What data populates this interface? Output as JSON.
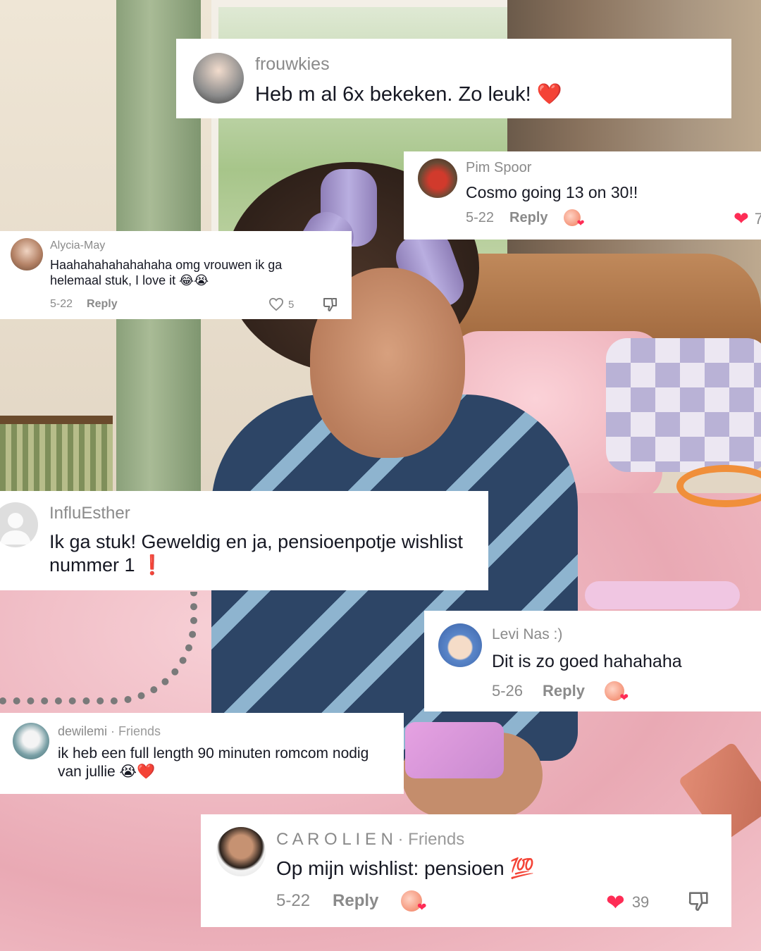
{
  "comments": [
    {
      "username": "frouwkies",
      "text": "Heb m al 6x bekeken. Zo leuk! ❤️"
    },
    {
      "username": "Pim Spoor",
      "text": "Cosmo going 13 on 30!!",
      "date": "5-22",
      "reply_label": "Reply",
      "likes": "7"
    },
    {
      "username": "Alycia-May",
      "text": "Haahahahahahahaha omg vrouwen ik ga helemaal stuk, I love it 😂😭",
      "date": "5-22",
      "reply_label": "Reply",
      "likes": "5"
    },
    {
      "username": "InfluEsther",
      "text": "Ik ga stuk! Geweldig en ja, pensioenpotje wishlist nummer 1 ❗"
    },
    {
      "username": "Levi Nas :)",
      "text": "Dit is zo goed hahahaha",
      "date": "5-26",
      "reply_label": "Reply"
    },
    {
      "username": "dewilemi",
      "friends_tag": " · Friends",
      "text": "ik heb een full length 90 minuten romcom nodig van jullie 😭❤️"
    },
    {
      "username": "C A R O L I E N",
      "friends_tag": " · Friends",
      "text": "Op mijn wishlist: pensioen 💯",
      "date": "5-22",
      "reply_label": "Reply",
      "likes": "39"
    }
  ],
  "icons": {
    "like": "heart-icon",
    "dislike": "thumbs-down-icon",
    "creator_liked": "creator-liked-badge-icon"
  },
  "colors": {
    "accent_red": "#fe2c55",
    "meta_gray": "#8a8a8a",
    "text_dark": "#161823"
  }
}
